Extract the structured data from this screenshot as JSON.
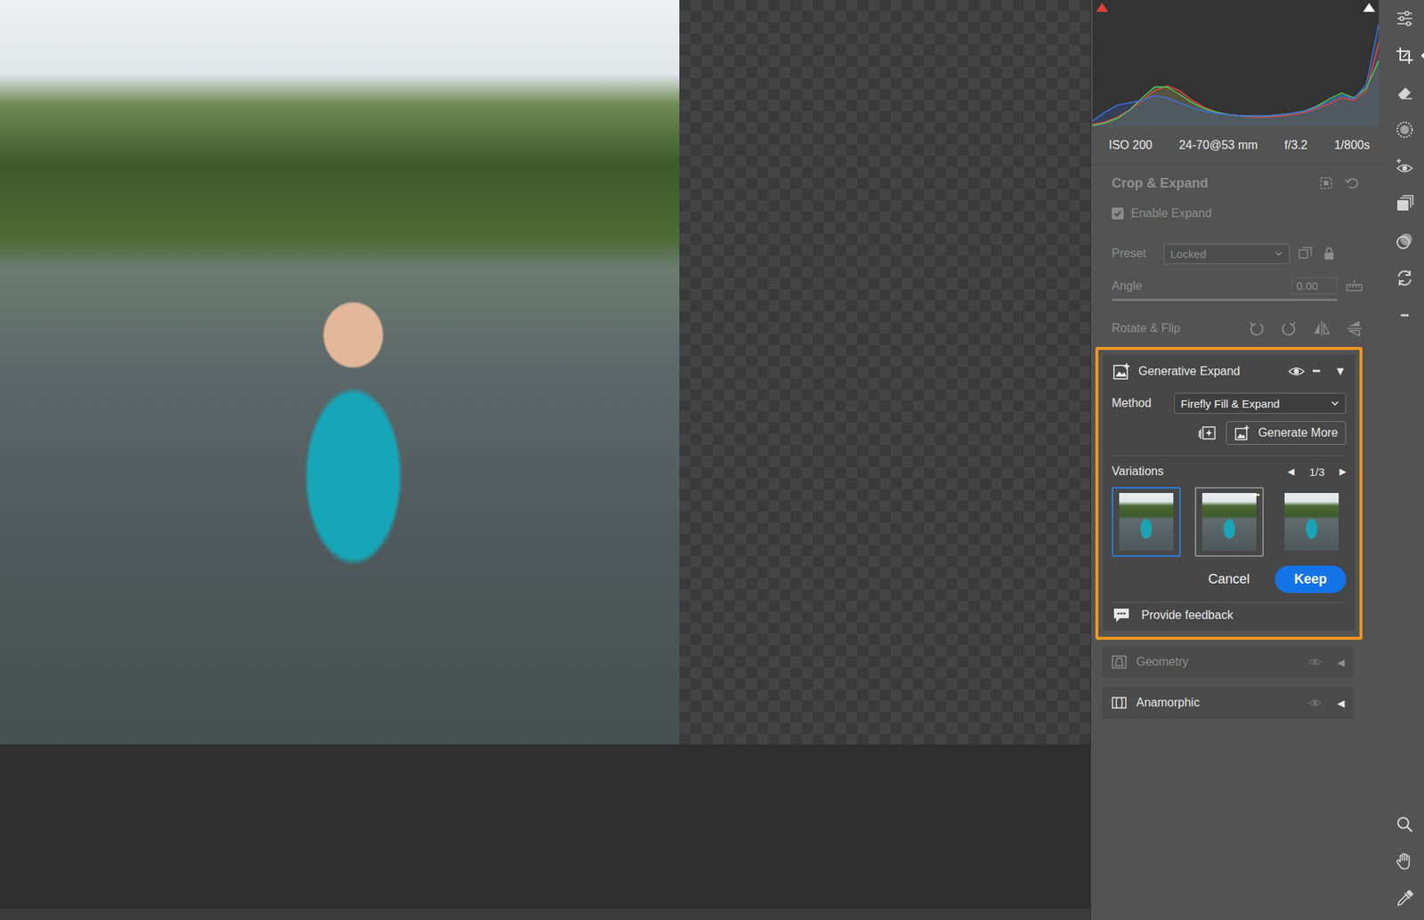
{
  "histogram": {
    "shadow_clipping": true,
    "highlight_clipping": false,
    "series": [
      {
        "name": "red",
        "color": "#e0483e",
        "values": [
          0.02,
          0.04,
          0.08,
          0.14,
          0.22,
          0.3,
          0.34,
          0.3,
          0.22,
          0.16,
          0.12,
          0.1,
          0.09,
          0.08,
          0.08,
          0.09,
          0.1,
          0.12,
          0.15,
          0.19,
          0.24,
          0.22,
          0.3,
          0.7
        ]
      },
      {
        "name": "green",
        "color": "#4fc35a",
        "values": [
          0.01,
          0.03,
          0.07,
          0.14,
          0.24,
          0.33,
          0.33,
          0.27,
          0.2,
          0.15,
          0.12,
          0.1,
          0.09,
          0.09,
          0.09,
          0.1,
          0.11,
          0.13,
          0.17,
          0.23,
          0.28,
          0.24,
          0.32,
          0.55
        ]
      },
      {
        "name": "blue",
        "color": "#3f6fe0",
        "values": [
          0.05,
          0.12,
          0.18,
          0.2,
          0.22,
          0.26,
          0.24,
          0.2,
          0.16,
          0.13,
          0.11,
          0.1,
          0.09,
          0.09,
          0.09,
          0.1,
          0.11,
          0.13,
          0.16,
          0.21,
          0.26,
          0.23,
          0.35,
          0.85
        ]
      }
    ]
  },
  "camera_info": [
    "ISO 200",
    "24-70@53 mm",
    "f/3.2",
    "1/800s"
  ],
  "crop_panel": {
    "title": "Crop & Expand",
    "disabled": true,
    "enable_expand": {
      "label": "Enable Expand",
      "checked": true
    },
    "preset": {
      "label": "Preset",
      "value": "Locked"
    },
    "angle": {
      "label": "Angle",
      "value": "0.00"
    },
    "rotate": {
      "label": "Rotate & Flip"
    }
  },
  "generative_expand": {
    "title": "Generative Expand",
    "more": "•••",
    "toggle": "▼",
    "method": {
      "label": "Method",
      "value": "Firefly Fill & Expand"
    },
    "generate_more": "Generate More",
    "variations": {
      "label": "Variations",
      "prev": "◀",
      "next": "▶",
      "counter": "1/3",
      "thumb_menu": "•••",
      "items": [
        {
          "selected": true,
          "hovered": false
        },
        {
          "selected": false,
          "hovered": true
        },
        {
          "selected": false,
          "hovered": false
        }
      ]
    },
    "cancel": "Cancel",
    "keep": "Keep",
    "feedback": "Provide feedback"
  },
  "sections": [
    {
      "title": "Geometry",
      "dimmed": true,
      "toggle": "◀"
    },
    {
      "title": "Anamorphic",
      "dimmed": false,
      "toggle": "◀"
    }
  ],
  "tools": [
    {
      "kind": "edit",
      "selected": false
    },
    {
      "kind": "crop",
      "selected": true
    },
    {
      "kind": "remove",
      "selected": false
    },
    {
      "kind": "mask",
      "selected": false
    },
    {
      "kind": "redeye",
      "selected": false
    },
    {
      "kind": "snapshots",
      "selected": false
    },
    {
      "kind": "presets",
      "selected": false
    },
    {
      "kind": "convert",
      "selected": false
    },
    {
      "kind": "more",
      "label": "•••",
      "selected": false
    }
  ],
  "view_tools": [
    {
      "kind": "zoom",
      "selected": false
    },
    {
      "kind": "hand",
      "selected": false
    },
    {
      "kind": "sampler",
      "selected": false
    }
  ]
}
